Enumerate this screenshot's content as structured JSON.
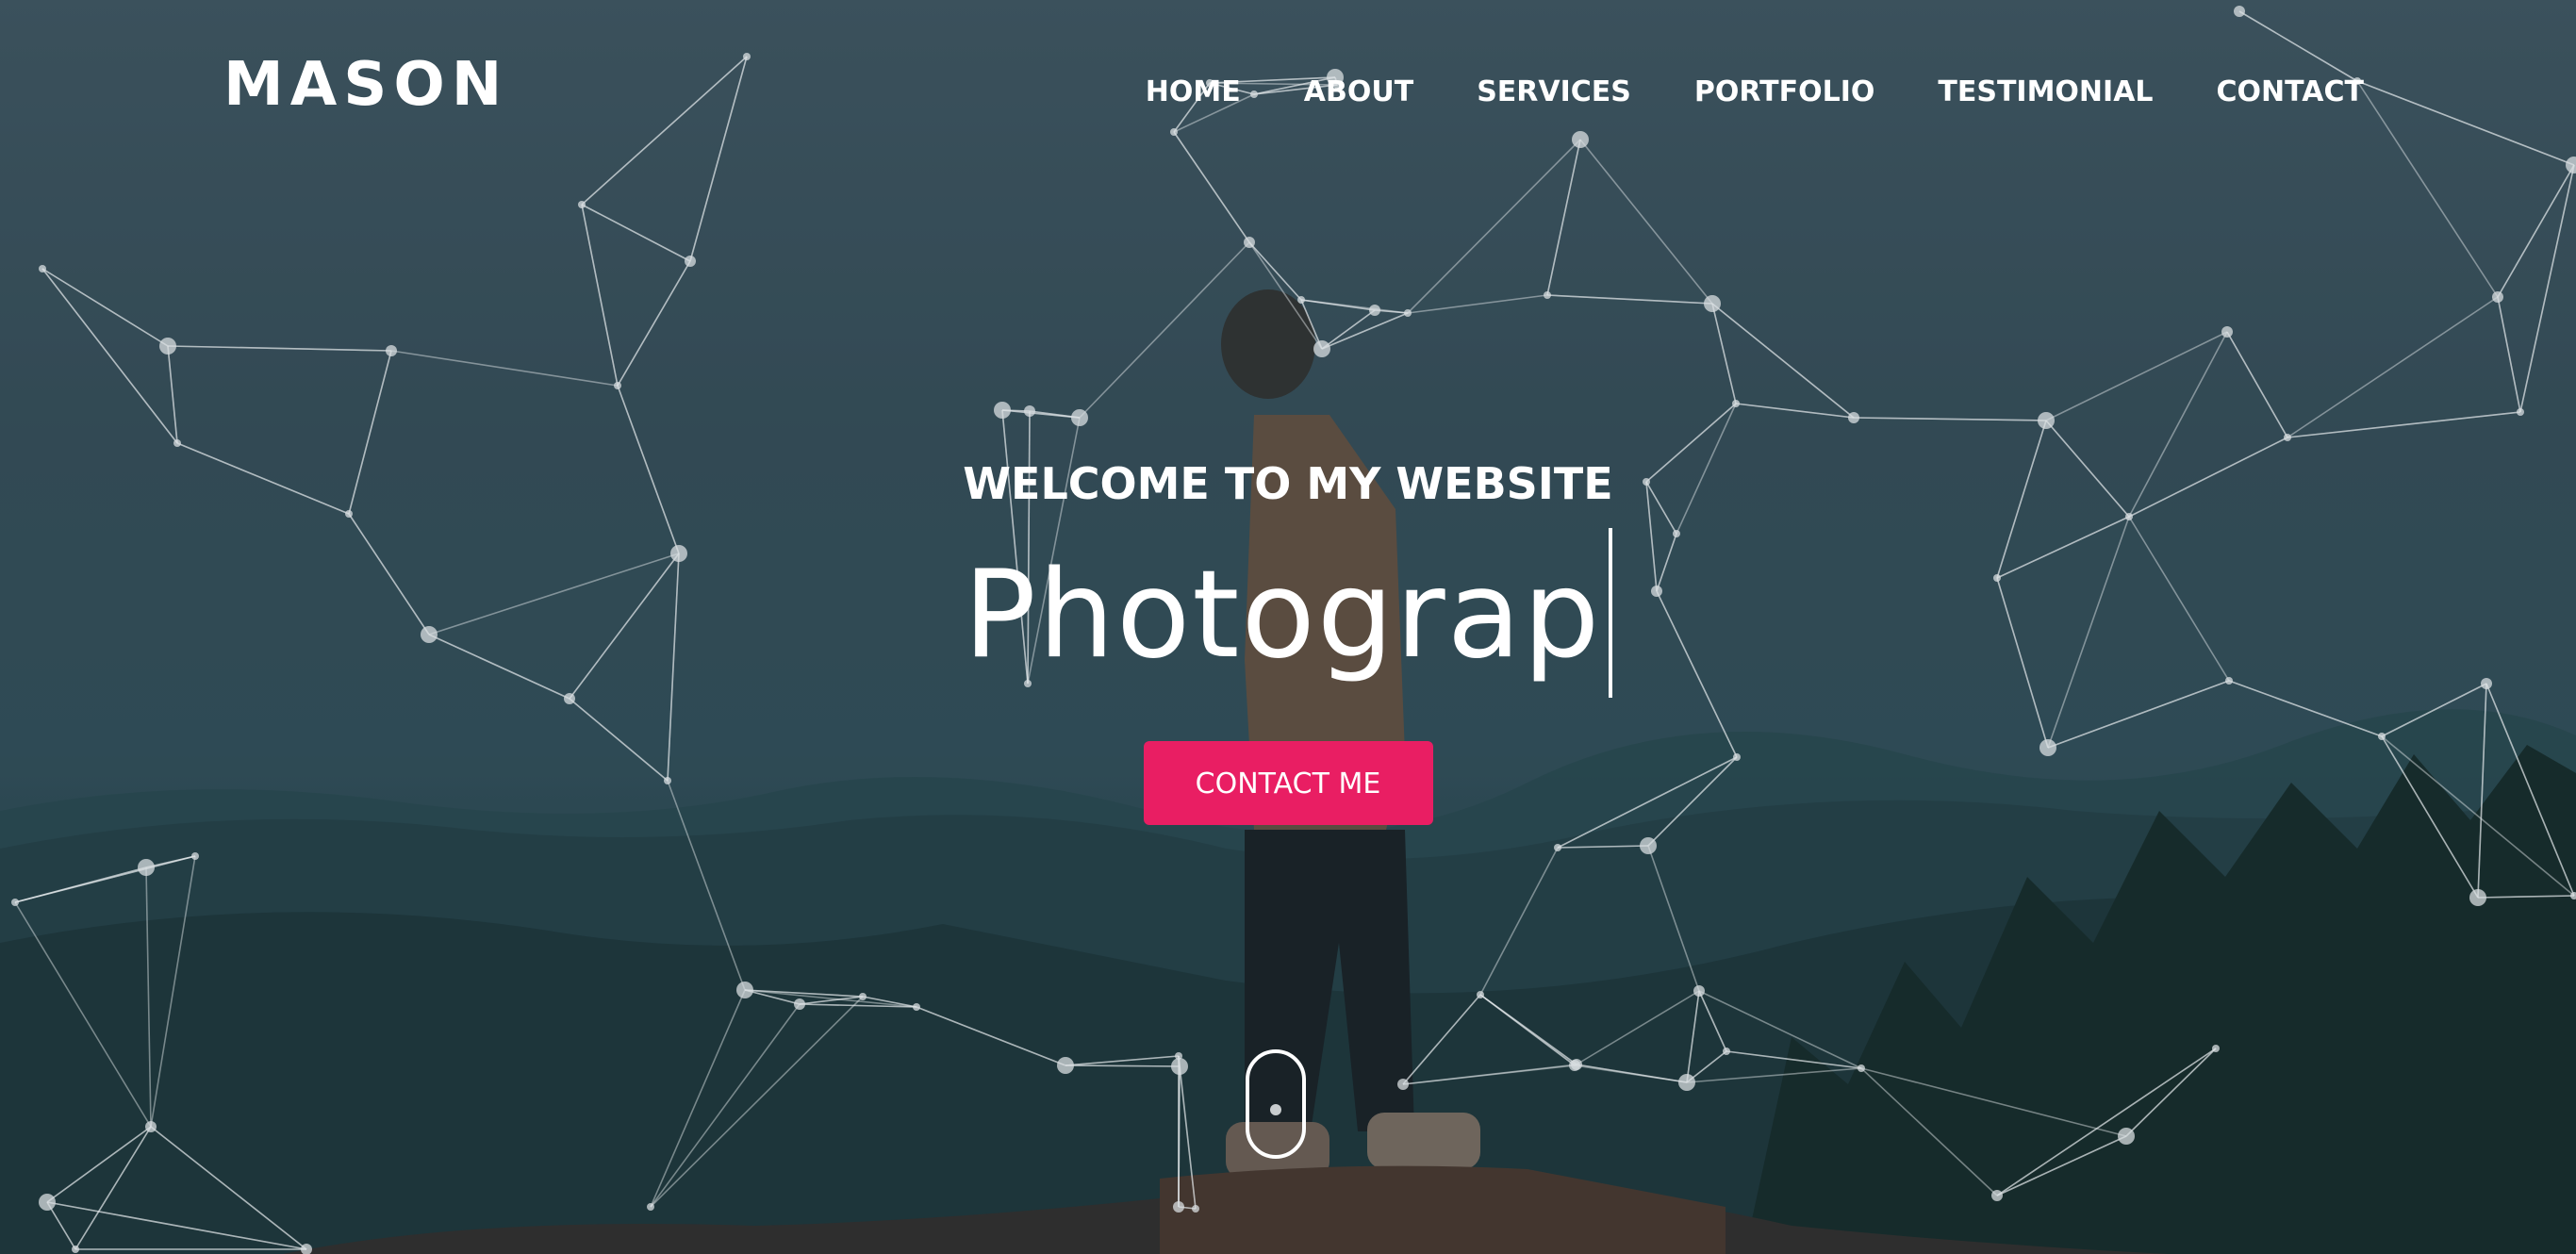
{
  "brand": {
    "name": "MASON"
  },
  "nav": {
    "items": [
      {
        "label": "HOME"
      },
      {
        "label": "ABOUT"
      },
      {
        "label": "SERVICES"
      },
      {
        "label": "PORTFOLIO"
      },
      {
        "label": "TESTIMONIAL"
      },
      {
        "label": "CONTACT"
      }
    ]
  },
  "hero": {
    "welcome": "WELCOME TO MY WEBSITE",
    "typed_text": "Photograp",
    "cta_label": "CONTACT ME"
  },
  "colors": {
    "accent": "#e91e63",
    "text": "#ffffff",
    "overlay": "#2b4450"
  },
  "icons": {
    "scroll": "mouse-scroll-icon"
  }
}
